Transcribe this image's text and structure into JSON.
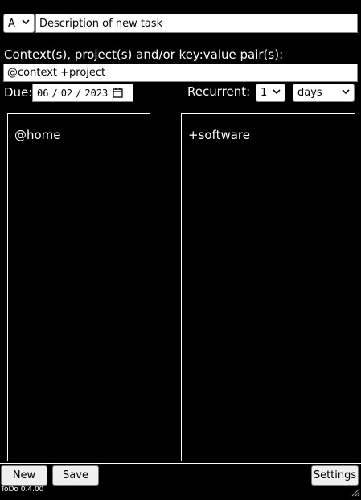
{
  "task": {
    "priority": "A",
    "description_placeholder": "Description of new task"
  },
  "context": {
    "label": "Context(s), project(s) and/or key:value pair(s):",
    "value": "@context +project"
  },
  "due": {
    "label": "Due:",
    "month": "06",
    "day": "02",
    "year": "2023"
  },
  "recurrent": {
    "label": "Recurrent:",
    "count": "1",
    "unit": "days"
  },
  "lists": {
    "contexts": [
      "@home"
    ],
    "projects": [
      "+software"
    ]
  },
  "footer": {
    "new_label": "New",
    "save_label": "Save",
    "settings_label": "Settings",
    "version": "ToDo 0.4.00"
  }
}
